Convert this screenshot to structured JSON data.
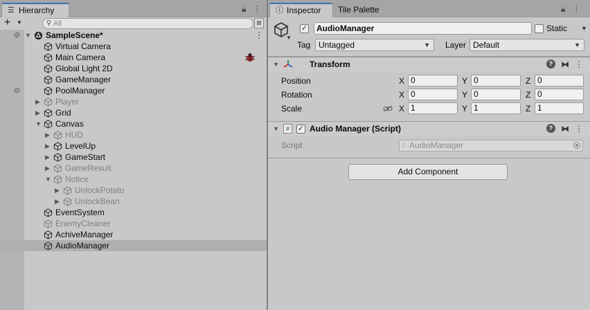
{
  "hierarchy": {
    "tab_label": "Hierarchy",
    "search_placeholder": "All",
    "scene": "SampleScene*",
    "items": [
      {
        "label": "Virtual Camera",
        "depth": 0,
        "expander": "none",
        "active": true
      },
      {
        "label": "Main Camera",
        "depth": 0,
        "expander": "none",
        "active": true
      },
      {
        "label": "Global Light 2D",
        "depth": 0,
        "expander": "none",
        "active": true
      },
      {
        "label": "GameManager",
        "depth": 0,
        "expander": "none",
        "active": true
      },
      {
        "label": "PoolManager",
        "depth": 0,
        "expander": "none",
        "active": true
      },
      {
        "label": "Player",
        "depth": 0,
        "expander": "collapsed",
        "active": false
      },
      {
        "label": "Grid",
        "depth": 0,
        "expander": "collapsed",
        "active": true
      },
      {
        "label": "Canvas",
        "depth": 0,
        "expander": "expanded",
        "active": true
      },
      {
        "label": "HUD",
        "depth": 1,
        "expander": "collapsed",
        "active": false
      },
      {
        "label": "LevelUp",
        "depth": 1,
        "expander": "collapsed",
        "active": true
      },
      {
        "label": "GameStart",
        "depth": 1,
        "expander": "collapsed",
        "active": true
      },
      {
        "label": "GameResult",
        "depth": 1,
        "expander": "collapsed",
        "active": false
      },
      {
        "label": "Notice",
        "depth": 1,
        "expander": "expanded",
        "active": false
      },
      {
        "label": "UnlockPotato",
        "depth": 2,
        "expander": "collapsed",
        "active": false
      },
      {
        "label": "UnlockBean",
        "depth": 2,
        "expander": "collapsed",
        "active": false
      },
      {
        "label": "EventSystem",
        "depth": 0,
        "expander": "none",
        "active": true
      },
      {
        "label": "EnemyCleaner",
        "depth": 0,
        "expander": "none",
        "active": false
      },
      {
        "label": "AchiveManager",
        "depth": 0,
        "expander": "none",
        "active": true
      },
      {
        "label": "AudioManager",
        "depth": 0,
        "expander": "none",
        "active": true,
        "selected": true
      }
    ]
  },
  "inspector": {
    "tab_label": "Inspector",
    "tab2_label": "Tile Palette",
    "object_name": "AudioManager",
    "static_label": "Static",
    "tag_label": "Tag",
    "tag_value": "Untagged",
    "layer_label": "Layer",
    "layer_value": "Default",
    "transform": {
      "title": "Transform",
      "rows": [
        {
          "label": "Position",
          "x": "0",
          "y": "0",
          "z": "0"
        },
        {
          "label": "Rotation",
          "x": "0",
          "y": "0",
          "z": "0"
        },
        {
          "label": "Scale",
          "x": "1",
          "y": "1",
          "z": "1"
        }
      ],
      "axis": {
        "x": "X",
        "y": "Y",
        "z": "Z"
      }
    },
    "script_component": {
      "title": "Audio Manager (Script)",
      "script_label": "Script",
      "script_value": "AudioManager"
    },
    "add_component_label": "Add Component"
  },
  "colors": {
    "panel_bg": "#c8c8c8",
    "selected_row": "#b0b0b0",
    "active_tab_accent": "#3a72b0"
  }
}
